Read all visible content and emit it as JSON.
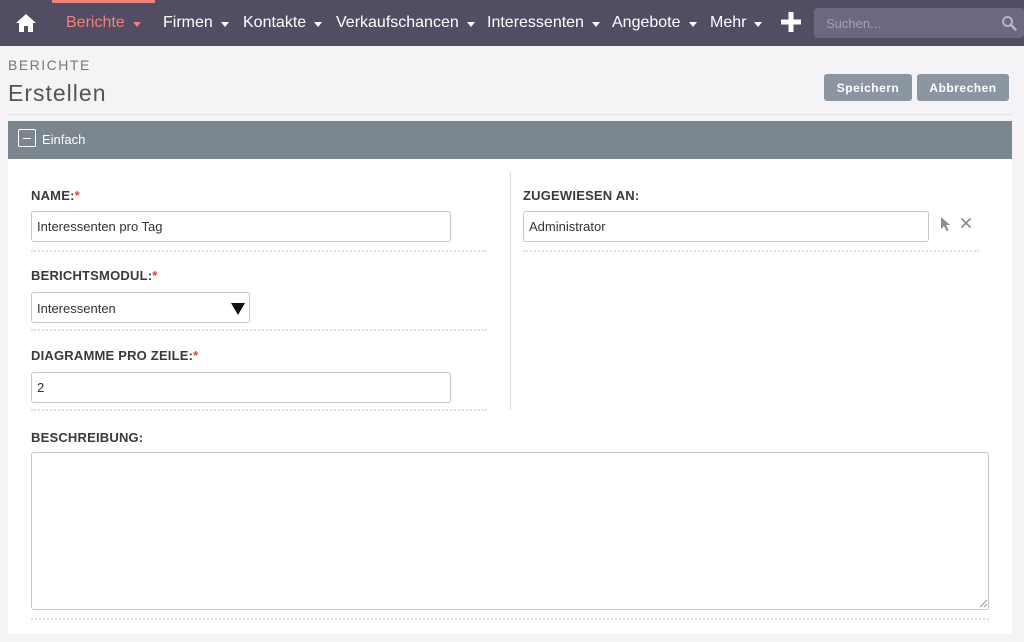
{
  "nav": {
    "items": [
      {
        "label": "Berichte",
        "active": true
      },
      {
        "label": "Firmen"
      },
      {
        "label": "Kontakte"
      },
      {
        "label": "Verkaufschancen"
      },
      {
        "label": "Interessenten"
      },
      {
        "label": "Angebote"
      },
      {
        "label": "Mehr"
      }
    ],
    "search_placeholder": "Suchen...",
    "colors": {
      "bar": "#534d64",
      "accent": "#f08377"
    },
    "icons": [
      "home-icon",
      "plus-icon",
      "search-icon"
    ]
  },
  "header": {
    "module": "BERICHTE",
    "title": "Erstellen",
    "save_label": "Speichern",
    "cancel_label": "Abbrechen"
  },
  "panel": {
    "label": "Einfach",
    "toggle_icon": "collapse-icon"
  },
  "form": {
    "name": {
      "label": "NAME:",
      "required_mark": "*",
      "value": "Interessenten pro Tag"
    },
    "module": {
      "label": "BERICHTSMODUL:",
      "required_mark": "*",
      "value": "Interessenten"
    },
    "charts_per_row": {
      "label": "DIAGRAMME PRO ZEILE:",
      "required_mark": "*",
      "value": "2"
    },
    "assigned_to": {
      "label": "ZUGEWIESEN AN:",
      "value": "Administrator",
      "icons": [
        "select-arrow-icon",
        "clear-icon"
      ]
    },
    "description": {
      "label": "BESCHREIBUNG:",
      "value": ""
    }
  }
}
